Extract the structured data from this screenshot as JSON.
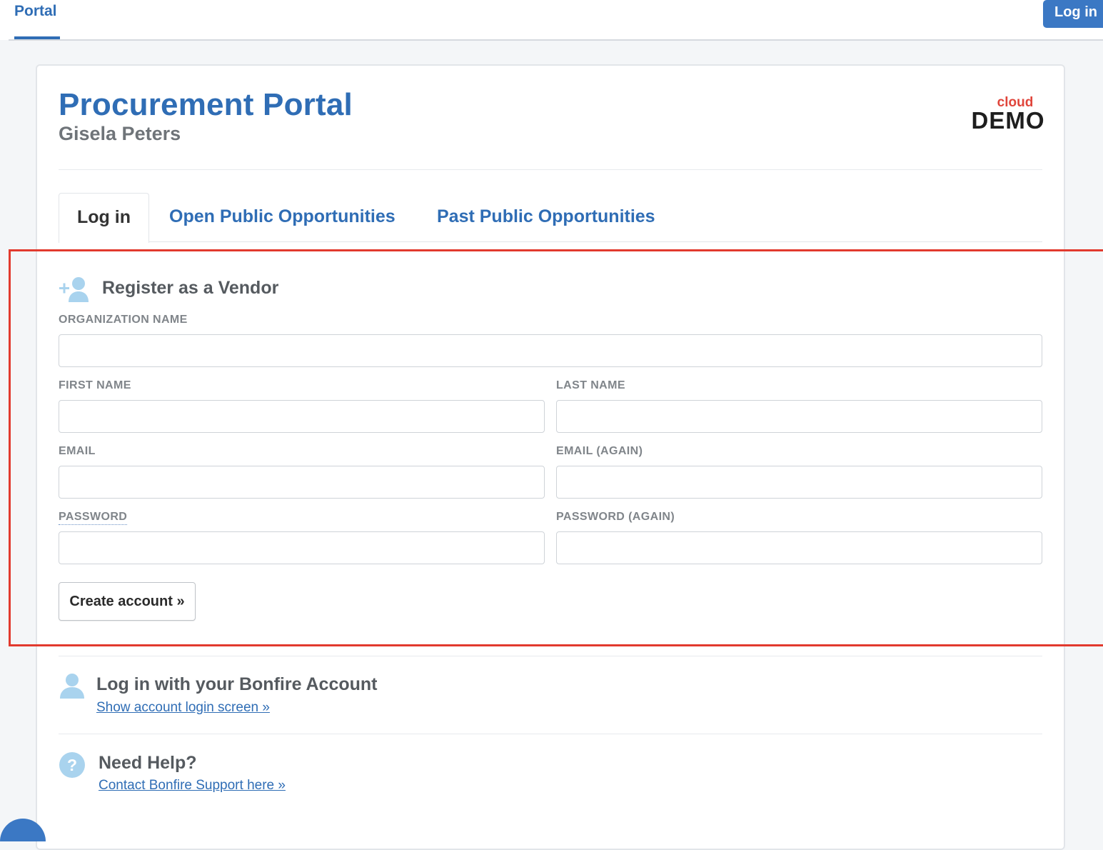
{
  "topnav": {
    "portal_label": "Portal",
    "login_label": "Log in"
  },
  "header": {
    "title": "Procurement Portal",
    "subtitle": "Gisela Peters",
    "brand_small": "cloud",
    "brand_big": "DEMO"
  },
  "tabs": [
    {
      "label": "Log in",
      "active": true
    },
    {
      "label": "Open Public Opportunities",
      "active": false
    },
    {
      "label": "Past Public Opportunities",
      "active": false
    }
  ],
  "register": {
    "title": "Register as a Vendor",
    "organization_label": "ORGANIZATION NAME",
    "first_name_label": "FIRST NAME",
    "last_name_label": "LAST NAME",
    "email_label": "EMAIL",
    "email_again_label": "EMAIL (AGAIN)",
    "password_label": "PASSWORD",
    "password_again_label": "PASSWORD (AGAIN)",
    "create_button": "Create account »"
  },
  "bonfire_login": {
    "title": "Log in with your Bonfire Account",
    "link": "Show account login screen »"
  },
  "help": {
    "title": "Need Help?",
    "link": "Contact Bonfire Support here »"
  },
  "colors": {
    "accent": "#2f6db5",
    "highlight": "#e23a2e",
    "icon": "#a9d3ee"
  }
}
